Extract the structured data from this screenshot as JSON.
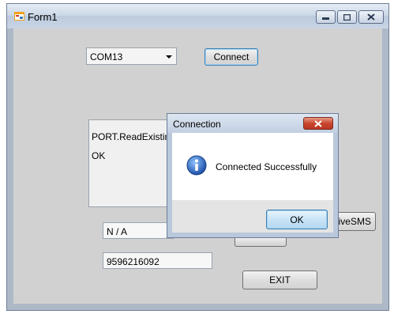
{
  "window": {
    "title": "Form1",
    "icon": "form-app-icon"
  },
  "caption_buttons": {
    "minimize": "minimize-icon",
    "maximize": "maximize-icon",
    "close": "close-icon"
  },
  "port_combo": {
    "selected": "COM13"
  },
  "buttons": {
    "connect": "Connect",
    "exit": "EXIT",
    "send": "",
    "receive": "eiveSMS"
  },
  "output_box": {
    "line1": "PORT.ReadExisting R",
    "line2": "OK"
  },
  "inputs": {
    "status": "N / A",
    "phone": "9596216092"
  },
  "dialog": {
    "title": "Connection",
    "message": "Connected Successfully",
    "ok_label": "OK",
    "icon": "info-icon"
  },
  "colors": {
    "window_frame": "#aeb9c8",
    "client_bg": "#d1d1d1",
    "dialog_close": "#c9462f",
    "info_blue": "#1f5fb5"
  }
}
